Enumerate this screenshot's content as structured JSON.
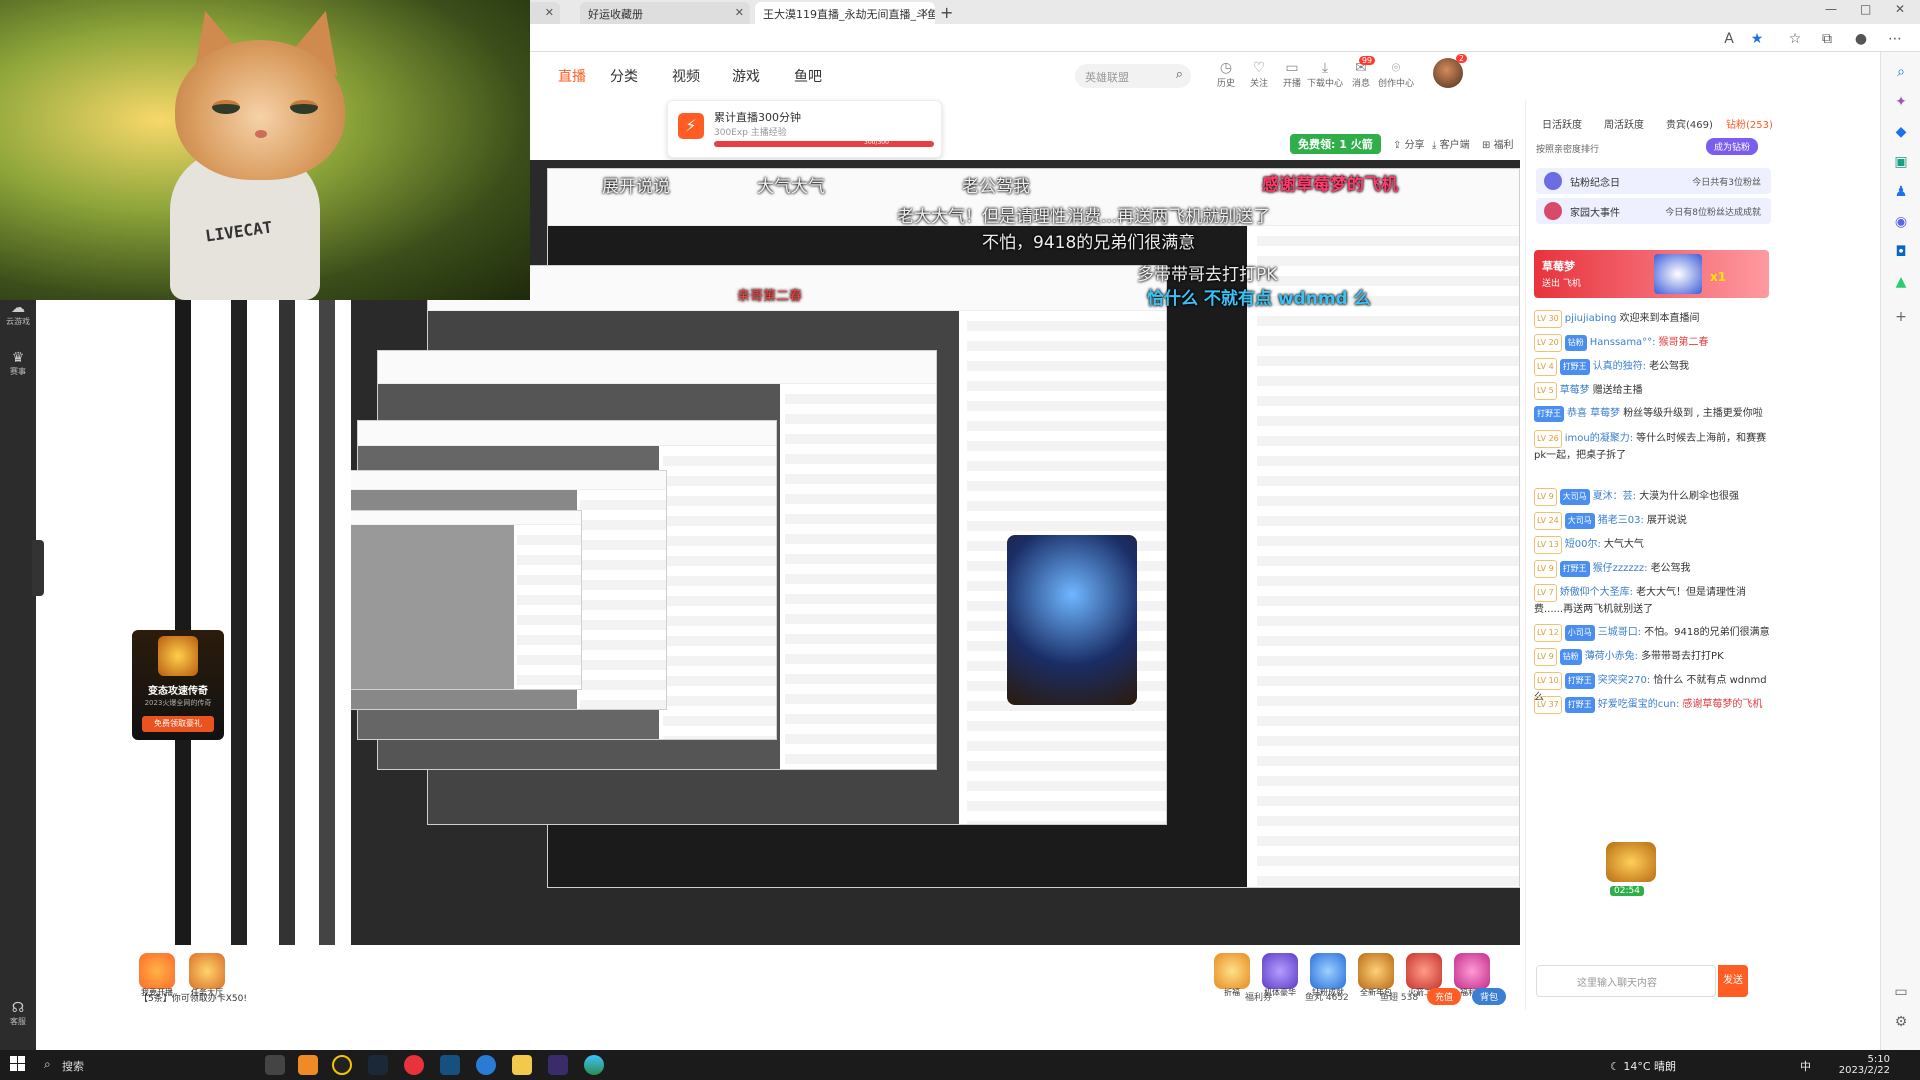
{
  "browser": {
    "tabs": [
      {
        "label": "好运收藏册"
      },
      {
        "label": "王大漠119直播_永劫无间直播_斗鱼"
      }
    ],
    "new_tab": "+",
    "window_controls": [
      "—",
      "□",
      "✕"
    ]
  },
  "nav": {
    "items": [
      "直播",
      "分类",
      "视频",
      "游戏",
      "鱼吧"
    ],
    "active_index": 0,
    "search_placeholder": "英雄联盟",
    "icons": [
      {
        "name": "history-icon",
        "label": "历史"
      },
      {
        "name": "follow-icon",
        "label": "关注"
      },
      {
        "name": "start-live-icon",
        "label": "开播"
      },
      {
        "name": "download-icon",
        "label": "下载中心"
      },
      {
        "name": "message-icon",
        "label": "消息",
        "badge": "99"
      },
      {
        "name": "creator-icon",
        "label": "创作中心"
      }
    ],
    "avatar_badge": "2"
  },
  "task_popup": {
    "title": "累计直播300分钟",
    "subtitle": "300Exp 主播经验",
    "progress_text": "300/300",
    "progress": 1.0
  },
  "stream_overlay": {
    "free_rocket": "免费领: 1 火箭",
    "share": "分享",
    "client": "客户端",
    "welfare": "福利",
    "danmu": [
      "展开说说",
      "大气大气",
      "老公驾我",
      "感谢草莓梦的飞机",
      "老大大气！但是请理性消费...再送两飞机就别送了",
      "不怕，9418的兄弟们很满意",
      "多带带哥去打打PK",
      "恰什么 不就有点 wdnmd 么",
      "亲哥第二春"
    ],
    "rocket_hint": "免费领: 火箭"
  },
  "webcam": {
    "shirt_text": "LIVECAT"
  },
  "rank_panel": {
    "tabs": [
      "日活跃度",
      "周活跃度",
      "贵宾(469)",
      "钻粉(253)"
    ],
    "rank_title": "按照亲密度排行",
    "become_fan": "成为钻粉",
    "events": [
      {
        "label": "钻粉纪念日",
        "right": "今日共有3位粉丝"
      },
      {
        "label": "家园大事件",
        "right": "今日有8位粉丝达成成就"
      }
    ],
    "rocket_banner": {
      "name": "草莓梦",
      "action": "送出 飞机",
      "count": "x1"
    }
  },
  "chat": {
    "lines": [
      {
        "lv": "LV 30",
        "badge": "",
        "user": "pjiujiabing",
        "text": "欢迎来到本直播间",
        "highlight": false
      },
      {
        "lv": "LV 20",
        "badge": "钻粉",
        "user": "Hanssama°°:",
        "text": "猴哥第二春",
        "highlight": true
      },
      {
        "lv": "LV 4",
        "badge": "打野王",
        "user": "认真的独符:",
        "text": "老公驾我",
        "highlight": false
      },
      {
        "lv": "LV 5",
        "badge": "",
        "user": "草莓梦",
        "text": "赠送给主播",
        "highlight": false
      },
      {
        "lv": "",
        "badge": "打野王",
        "user": "恭喜 草莓梦",
        "text": "粉丝等级升级到 , 主播更爱你啦",
        "highlight": false
      },
      {
        "lv": "LV 26",
        "badge": "",
        "user": "imou的凝聚力:",
        "text": "等什么时候去上海前，和赛赛pk一起，把桌子拆了",
        "highlight": false
      },
      {
        "lv": "LV 9",
        "badge": "大司马",
        "user": "夏沐：芸:",
        "text": "大漠为什么刷伞也很强",
        "highlight": false
      },
      {
        "lv": "LV 24",
        "badge": "大司马",
        "user": "猪老三03:",
        "text": "展开说说",
        "highlight": false
      },
      {
        "lv": "LV 13",
        "badge": "",
        "user": "短00尔:",
        "text": "大气大气",
        "highlight": false
      },
      {
        "lv": "LV 9",
        "badge": "打野王",
        "user": "猴仔zzzzzz:",
        "text": "老公驾我",
        "highlight": false
      },
      {
        "lv": "LV 7",
        "badge": "",
        "user": "娇傲仰个大圣库:",
        "text": "老大大气！但是请理性消费......再送两飞机就别送了",
        "highlight": false
      },
      {
        "lv": "LV 12",
        "badge": "小司马",
        "user": "三城哥口:",
        "text": "不怕。9418的兄弟们很满意",
        "highlight": false
      },
      {
        "lv": "LV 9",
        "badge": "钻粉",
        "user": "薄荷小赤兔:",
        "text": "多带带哥去打打PK",
        "highlight": false
      },
      {
        "lv": "LV 10",
        "badge": "打野王",
        "user": "突突突270:",
        "text": "恰什么 不就有点 wdnmd 么",
        "highlight": false
      },
      {
        "lv": "LV 37",
        "badge": "打野王",
        "user": "好爱吃蛋宝的cun:",
        "text": "感谢草莓梦的飞机",
        "highlight": true
      }
    ],
    "input_placeholder": "这里输入聊天内容",
    "send_label": "发送",
    "timer": "02:54"
  },
  "bottom_bar": {
    "notice": "【5条】你可领取办卡X50!",
    "gifts": [
      "我要开播",
      "任务大厅"
    ],
    "right_gifts": [
      "折福",
      "机体豪华",
      "钻粉成就",
      "全新年包",
      "火箭工厂",
      "福利社"
    ],
    "stats": [
      "福利券",
      "鱼丸 4652",
      "鱼翅 538"
    ],
    "recharge": "充值",
    "backpack": "背包"
  },
  "promo": {
    "title": "变态攻速传奇",
    "subtitle": "2023火爆全网的传奇",
    "button": "免费领取豪礼"
  },
  "left_strip": [
    {
      "label": "云游戏",
      "icon": "cloud-game-icon"
    },
    {
      "label": "赛事",
      "icon": "trophy-icon"
    },
    {
      "label": "客服",
      "icon": "headset-icon"
    }
  ],
  "taskbar": {
    "search_placeholder": "搜索",
    "weather": "14°C 晴朗",
    "time": "5:10",
    "date": "2023/2/22",
    "ime": "中"
  },
  "colors": {
    "accent": "#ff5d23",
    "chat_user": "#3a7fd1",
    "highlight": "#e23d3d"
  }
}
